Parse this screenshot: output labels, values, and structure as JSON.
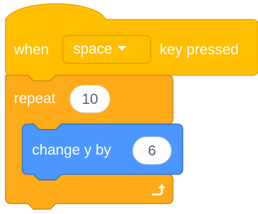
{
  "colors": {
    "events": "#ffbf00",
    "events_dark": "#e6a700",
    "control": "#ffab19",
    "control_dark": "#cf8b17",
    "motion": "#4c97ff",
    "motion_dark": "#3373cc"
  },
  "hat_block": {
    "prefix": "when",
    "key_dropdown": "space",
    "dropdown_icon": "caret-down-icon",
    "suffix": "key pressed"
  },
  "repeat_block": {
    "label": "repeat",
    "count": "10",
    "loop_icon": "loop-arrow-icon"
  },
  "motion_block": {
    "label": "change y by",
    "value": "6"
  }
}
